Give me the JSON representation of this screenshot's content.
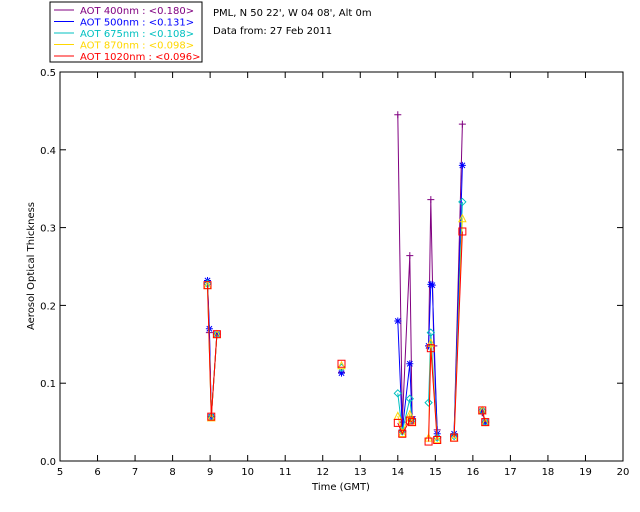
{
  "chart_data": {
    "type": "line",
    "xlabel": "Time (GMT)",
    "ylabel": "Aerosol Optical Thickness",
    "xlim": [
      5,
      20
    ],
    "ylim": [
      0,
      0.5
    ],
    "x_ticks": [
      "5",
      "6",
      "7",
      "8",
      "9",
      "10",
      "11",
      "12",
      "13",
      "14",
      "15",
      "16",
      "17",
      "18",
      "19",
      "20"
    ],
    "y_ticks": [
      "0.0",
      "0.1",
      "0.2",
      "0.3",
      "0.4",
      "0.5"
    ],
    "grid": false,
    "legend_position": "top-left (outside plot)",
    "info_lines": [
      "PML, N 50 22', W 04 08', Alt 0m",
      "Data from: 27 Feb 2011"
    ],
    "series": [
      {
        "name": "AOT  400nm : <0.180>",
        "color": "#800080",
        "marker": "plus",
        "segments": [
          [
            [
              8.93,
              0.232
            ],
            [
              8.98,
              0.165
            ],
            [
              9.03,
              0.057
            ],
            [
              9.18,
              0.163
            ]
          ],
          [
            [
              14.0,
              0.445
            ],
            [
              14.12,
              0.05
            ],
            [
              14.32,
              0.264
            ],
            [
              14.38,
              0.057
            ]
          ],
          [
            [
              14.82,
              0.148
            ],
            [
              14.88,
              0.336
            ],
            [
              14.96,
              0.148
            ],
            [
              15.05,
              0.04
            ]
          ],
          [
            [
              15.5,
              0.035
            ],
            [
              15.72,
              0.433
            ]
          ],
          [
            [
              16.25,
              0.062
            ],
            [
              16.33,
              0.05
            ]
          ]
        ],
        "isolated": [
          [
            12.5,
            0.114
          ]
        ]
      },
      {
        "name": "AOT  500nm : <0.131>",
        "color": "#0000ff",
        "marker": "star",
        "segments": [
          [
            [
              8.93,
              0.232
            ],
            [
              8.98,
              0.17
            ],
            [
              9.03,
              0.057
            ],
            [
              9.18,
              0.163
            ]
          ],
          [
            [
              14.0,
              0.18
            ],
            [
              14.12,
              0.04
            ],
            [
              14.32,
              0.125
            ],
            [
              14.38,
              0.053
            ]
          ],
          [
            [
              14.82,
              0.148
            ],
            [
              14.88,
              0.227
            ],
            [
              14.92,
              0.226
            ],
            [
              15.05,
              0.035
            ]
          ],
          [
            [
              15.5,
              0.035
            ],
            [
              15.72,
              0.38
            ]
          ],
          [
            [
              16.25,
              0.064
            ],
            [
              16.33,
              0.05
            ]
          ]
        ],
        "isolated": [
          [
            12.5,
            0.113
          ]
        ]
      },
      {
        "name": "AOT  675nm : <0.108>",
        "color": "#00c0c0",
        "marker": "diamond",
        "segments": [
          [
            [
              8.93,
              0.228
            ],
            [
              9.03,
              0.057
            ],
            [
              9.18,
              0.163
            ]
          ],
          [
            [
              14.0,
              0.087
            ],
            [
              14.12,
              0.038
            ],
            [
              14.32,
              0.08
            ],
            [
              14.38,
              0.052
            ]
          ],
          [
            [
              14.82,
              0.075
            ],
            [
              14.88,
              0.165
            ],
            [
              15.05,
              0.03
            ]
          ],
          [
            [
              15.5,
              0.032
            ],
            [
              15.72,
              0.333
            ]
          ],
          [
            [
              16.25,
              0.065
            ],
            [
              16.33,
              0.05
            ]
          ]
        ],
        "isolated": [
          [
            12.5,
            0.12
          ]
        ]
      },
      {
        "name": "AOT  870nm : <0.098>",
        "color": "#ffd700",
        "marker": "triangle",
        "segments": [
          [
            [
              8.93,
              0.226
            ],
            [
              9.03,
              0.056
            ],
            [
              9.18,
              0.163
            ]
          ],
          [
            [
              14.0,
              0.058
            ],
            [
              14.12,
              0.036
            ],
            [
              14.32,
              0.06
            ],
            [
              14.38,
              0.05
            ]
          ],
          [
            [
              14.82,
              0.03
            ],
            [
              14.88,
              0.152
            ],
            [
              15.05,
              0.028
            ]
          ],
          [
            [
              15.5,
              0.03
            ],
            [
              15.72,
              0.312
            ]
          ],
          [
            [
              16.25,
              0.065
            ],
            [
              16.33,
              0.05
            ]
          ]
        ],
        "isolated": [
          [
            12.5,
            0.123
          ]
        ]
      },
      {
        "name": "AOT 1020nm : <0.096>",
        "color": "#ff0000",
        "marker": "square",
        "segments": [
          [
            [
              8.93,
              0.226
            ],
            [
              9.03,
              0.057
            ],
            [
              9.18,
              0.163
            ]
          ],
          [
            [
              14.0,
              0.049
            ],
            [
              14.12,
              0.035
            ],
            [
              14.32,
              0.052
            ],
            [
              14.38,
              0.05
            ]
          ],
          [
            [
              14.82,
              0.025
            ],
            [
              14.88,
              0.145
            ],
            [
              15.05,
              0.027
            ]
          ],
          [
            [
              15.5,
              0.03
            ],
            [
              15.72,
              0.295
            ]
          ],
          [
            [
              16.25,
              0.065
            ],
            [
              16.33,
              0.05
            ]
          ]
        ],
        "isolated": [
          [
            12.5,
            0.125
          ]
        ]
      }
    ]
  }
}
